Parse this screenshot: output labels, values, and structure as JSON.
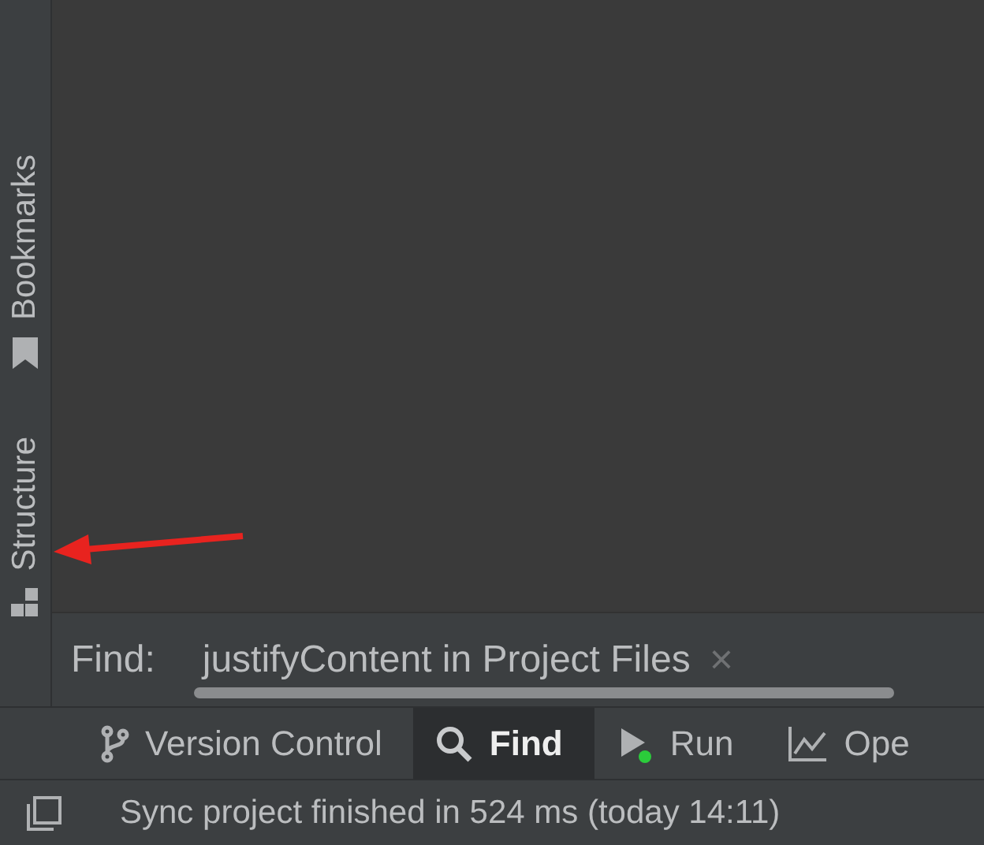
{
  "side_stripe": [
    {
      "label": "Bookmarks",
      "kind": "bookmark"
    },
    {
      "label": "Structure",
      "kind": "structure"
    }
  ],
  "find_bar": {
    "label": "Find:",
    "tab": "justifyContent in Project Files",
    "close": "×"
  },
  "tool_tabs": [
    {
      "label": "Version Control",
      "kind": "vcs",
      "selected": false
    },
    {
      "label": "Find",
      "kind": "find",
      "selected": true
    },
    {
      "label": "Run",
      "kind": "run",
      "selected": false
    },
    {
      "label": "Ope",
      "kind": "chart",
      "selected": false
    }
  ],
  "status_bar": {
    "message": "Sync project finished in 524 ms (today 14:11)"
  }
}
